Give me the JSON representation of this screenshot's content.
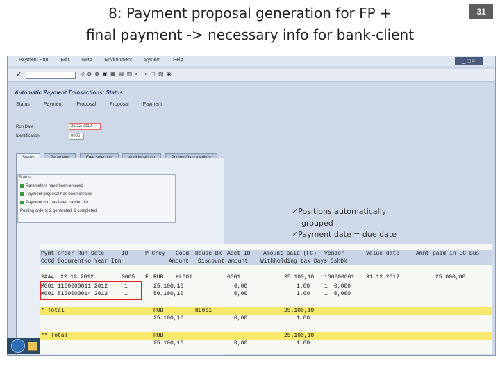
{
  "slide": {
    "title_line1": "8: Payment proposal generation for FP +",
    "title_line2": "final payment -> necessary info for bank-client",
    "page_number": "31"
  },
  "sap": {
    "menu": [
      "Payment Run",
      "Edit",
      "Goto",
      "Environment",
      "System",
      "Help"
    ],
    "window_controls": "_ □ ×",
    "toolbar_glyphs": "◁ ⊛ ⊗ ▣ ▦ ▤ ▥ ⇤ ⇥ ▢ ▨ ◉",
    "screen_title": "Automatic Payment Transactions: Status",
    "app_toolbar": [
      "Status",
      "Payment",
      "Proposal",
      "Proposal",
      "Payment"
    ],
    "run_date_label": "Run Date",
    "run_date_value": "22.12.2012",
    "identification_label": "Identification",
    "identification_value": "0005",
    "tabs": [
      "Status",
      "Parameter",
      "Free selection",
      "Additional Log",
      "Printout/data medium"
    ],
    "status_title": "Status",
    "status_lines": [
      "Parameters have been entered",
      "Payment proposal has been created",
      "Payment run has been carried out",
      "Posting orders: 2 generated, 2 completed"
    ]
  },
  "callout": {
    "line1": "✓Positions automatically",
    "line2": "grouped",
    "line3": "✓Payment date = due date"
  },
  "report": {
    "header1": {
      "c1": "Pymt.order Run Date",
      "c2": "ID",
      "c3": "P Crcy",
      "c4": "CoCd",
      "c5": "House Bk",
      "c6": "Acct ID",
      "c7": "Amount paid (FC)",
      "c8": "Vendor",
      "c9": "Value date",
      "c10": "Amnt paid in LC Bus"
    },
    "header2": {
      "c1": "CoCd DocumentNo Year Itm",
      "c2": "Amount",
      "c3": "Discount amount",
      "c4": "Withholding tax Days CshD%"
    },
    "rows": [
      {
        "c1": "2AA4",
        "c2": "22.12.2012",
        "c3": "0005",
        "c4": "F",
        "c5": "RUB",
        "c6": "HL001",
        "c7": "0001",
        "c8": "25.100,10",
        "c9": "100000001",
        "c10": "31.12.2012",
        "c11": "25.000,00"
      },
      {
        "c1": "M001 1100000011 2012",
        "c2": "1",
        "c3": "25.100,10",
        "c4": "0,00",
        "c5": "1.00",
        "c6": "1",
        "c7": "0,000"
      },
      {
        "c1": "M001 5100000014 2012",
        "c2": "1",
        "c3": "50.100,10",
        "c4": "0,00",
        "c5": "1.00",
        "c6": "1",
        "c7": "0,000"
      }
    ],
    "total1": {
      "label": "* Total",
      "crcy": "RUB",
      "bank": "HL001",
      "amount": "25.100,10"
    },
    "total1_sub": {
      "amount": "25.100,10",
      "discount": "0,00",
      "wht": "1.00"
    },
    "total2": {
      "label": "** Total",
      "crcy": "RUB",
      "amount": "25.100,10"
    },
    "total2_sub": {
      "amount": "25.100,10",
      "discount": "0,00",
      "wht": "1.00"
    }
  }
}
